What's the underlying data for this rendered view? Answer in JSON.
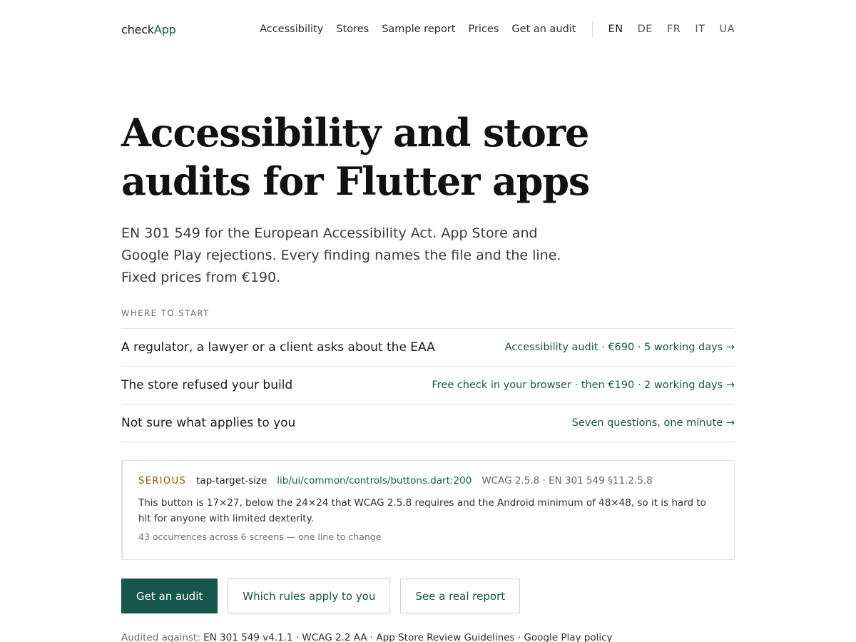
{
  "header": {
    "logo_part1": "check",
    "logo_part2": "App",
    "nav": [
      "Accessibility",
      "Stores",
      "Sample report",
      "Prices",
      "Get an audit"
    ],
    "languages": [
      "EN",
      "DE",
      "FR",
      "IT",
      "UA"
    ],
    "active_language": "EN"
  },
  "hero": {
    "title_line1": "Accessibility and store",
    "title_line2": "audits for Flutter apps",
    "lead": "EN 301 549 for the European Accessibility Act. App Store and Google Play rejections. Every finding names the file and the line. Fixed prices from €190."
  },
  "start": {
    "eyebrow": "Where to start",
    "rows": [
      {
        "question": "A regulator, a lawyer or a client asks about the EAA",
        "answer": "Accessibility audit · €690 · 5 working days →"
      },
      {
        "question": "The store refused your build",
        "answer": "Free check in your browser · then €190 · 2 working days →"
      },
      {
        "question": "Not sure what applies to you",
        "answer": "Seven questions, one minute →"
      }
    ]
  },
  "finding": {
    "severity": "SERIOUS",
    "rule": "tap-target-size",
    "path": "lib/ui/common/controls/buttons.dart:200",
    "standards": "WCAG 2.5.8 · EN 301 549 §11.2.5.8",
    "description": "This button is 17×27, below the 24×24 that WCAG 2.5.8 requires and the Android minimum of 48×48, so it is hard to hit for anyone with limited dexterity.",
    "occurrences": "43 occurrences across 6 screens — one line to change",
    "severity_color": "#8a5a00"
  },
  "actions": {
    "primary": "Get an audit",
    "secondary": "Which rules apply to you",
    "tertiary": "See a real report"
  },
  "footer": {
    "audited_label": "Audited against:",
    "audited_list": "EN 301 549 v4.1.1 · WCAG 2.2 AA · App Store Review Guidelines · Google Play policy"
  },
  "colors": {
    "accent": "#17574a",
    "text": "#1a1a1a",
    "border": "#e3e3e3"
  }
}
